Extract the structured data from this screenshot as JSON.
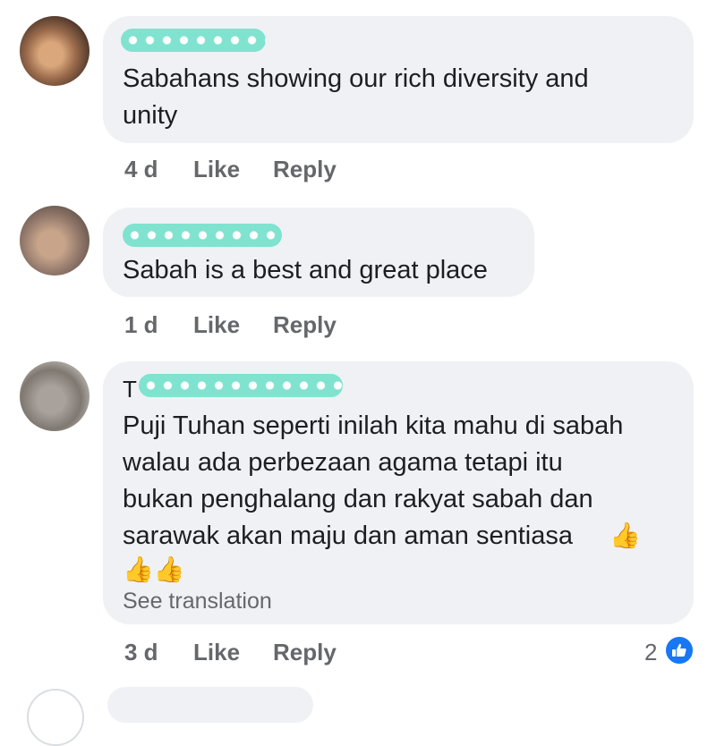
{
  "comments": [
    {
      "text_lines": [
        "Sabahans showing our rich diversity and",
        "unity"
      ],
      "time": "4 d",
      "like": "Like",
      "reply": "Reply"
    },
    {
      "text_lines": [
        "Sabah is a best and great place"
      ],
      "time": "1 d",
      "like": "Like",
      "reply": "Reply"
    },
    {
      "name_initial": "T",
      "text_lines": [
        "Puji Tuhan seperti inilah kita mahu di sabah",
        "walau ada perbezaan agama tetapi itu",
        "bukan penghalang dan rakyat sabah dan",
        "sarawak akan maju dan aman sentiasa"
      ],
      "thumbs_inline": "👍",
      "thumbs_line": "👍👍",
      "see_translation": "See translation",
      "time": "3 d",
      "like": "Like",
      "reply": "Reply",
      "reaction_count": "2",
      "reaction_icon": "like-thumbs-up-icon",
      "reaction_color": "#1877f2"
    }
  ],
  "colors": {
    "bubble": "#eff1f5",
    "meta_text": "#65676b",
    "name_mask": "#7fe3cf"
  }
}
